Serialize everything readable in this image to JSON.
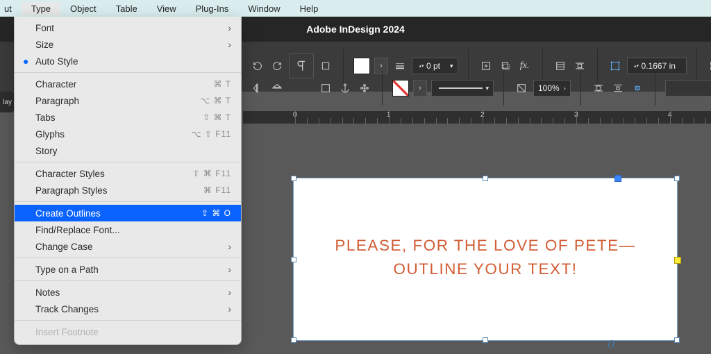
{
  "menubar": {
    "items": [
      "ut",
      "Type",
      "Object",
      "Table",
      "View",
      "Plug-Ins",
      "Window",
      "Help"
    ],
    "open_index": 1
  },
  "app_title": "Adobe InDesign 2024",
  "doc_tab": "lay",
  "type_menu": {
    "rows": [
      {
        "label": "Font",
        "kind": "submenu"
      },
      {
        "label": "Size",
        "kind": "submenu"
      },
      {
        "label": "Auto Style",
        "kind": "bullet"
      },
      {
        "sep": true
      },
      {
        "label": "Character",
        "shortcut": "⌘ T"
      },
      {
        "label": "Paragraph",
        "shortcut": "⌥ ⌘ T"
      },
      {
        "label": "Tabs",
        "shortcut": "⇧ ⌘ T"
      },
      {
        "label": "Glyphs",
        "shortcut": "⌥ ⇧ F11"
      },
      {
        "label": "Story"
      },
      {
        "sep": true
      },
      {
        "label": "Character Styles",
        "shortcut": "⇧ ⌘ F11"
      },
      {
        "label": "Paragraph Styles",
        "shortcut": "⌘ F11"
      },
      {
        "sep": true
      },
      {
        "label": "Create Outlines",
        "shortcut": "⇧ ⌘ O",
        "highlight": true
      },
      {
        "label": "Find/Replace Font..."
      },
      {
        "label": "Change Case",
        "kind": "submenu"
      },
      {
        "sep": true
      },
      {
        "label": "Type on a Path",
        "kind": "submenu"
      },
      {
        "sep": true
      },
      {
        "label": "Notes",
        "kind": "submenu"
      },
      {
        "label": "Track Changes",
        "kind": "submenu"
      },
      {
        "sep": true
      },
      {
        "label": "Insert Footnote",
        "disabled": true
      }
    ]
  },
  "control_bar": {
    "stroke_value": "0 pt",
    "opacity_value": "100%",
    "field_value": "0.1667 in"
  },
  "ruler_marks": [
    "0",
    "1",
    "2",
    "3",
    "4"
  ],
  "text_content": {
    "line1": "PLEASE, FOR THE LOVE OF PETE—",
    "line2": "OUTLINE YOUR TEXT!"
  }
}
